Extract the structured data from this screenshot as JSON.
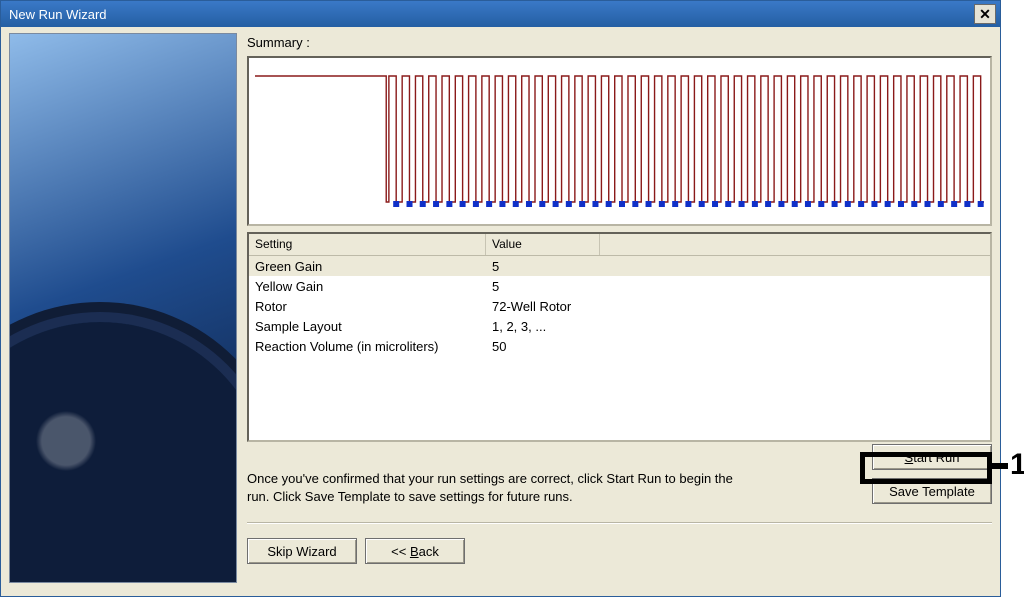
{
  "window": {
    "title": "New Run Wizard"
  },
  "summary_label": "Summary :",
  "table": {
    "headers": {
      "setting": "Setting",
      "value": "Value"
    },
    "rows": [
      {
        "setting": "Green Gain",
        "value": "5"
      },
      {
        "setting": "Yellow Gain",
        "value": "5"
      },
      {
        "setting": "Rotor",
        "value": "72-Well Rotor"
      },
      {
        "setting": "Sample Layout",
        "value": "1, 2, 3, ..."
      },
      {
        "setting": "Reaction Volume (in microliters)",
        "value": "50"
      }
    ]
  },
  "info_text": "Once you've confirmed that your run settings are correct, click Start Run to begin the run. Click Save Template to save settings for future runs.",
  "buttons": {
    "start_run_pre": "S",
    "start_run_rest": "tart Run",
    "save_template": "Save Template",
    "skip_wizard": "Skip Wizard",
    "back_pre": "<< ",
    "back_u": "B",
    "back_rest": "ack"
  },
  "callout_number": "1",
  "chart_data": {
    "type": "line",
    "title": "",
    "xlabel": "",
    "ylabel": "",
    "hold_segment_fraction": 0.18,
    "cycle_count": 45,
    "cycle_high": 1.0,
    "cycle_low": 0.0,
    "hold_level": 1.0,
    "acquisition_marker": true
  }
}
